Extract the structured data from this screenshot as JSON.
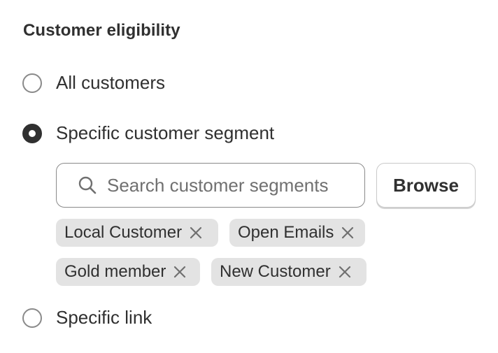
{
  "section": {
    "title": "Customer eligibility"
  },
  "options": {
    "all": {
      "label": "All customers",
      "selected": false
    },
    "segment": {
      "label": "Specific customer segment",
      "selected": true
    },
    "link": {
      "label": "Specific link",
      "selected": false
    }
  },
  "search": {
    "placeholder": "Search customer segments",
    "value": ""
  },
  "browse_label": "Browse",
  "tags": [
    {
      "label": "Local Customer"
    },
    {
      "label": "Open Emails"
    },
    {
      "label": "Gold member"
    },
    {
      "label": "New Customer"
    }
  ],
  "colors": {
    "text": "#303030",
    "tag_bg": "#e3e3e3",
    "border": "#8a8a8a"
  }
}
